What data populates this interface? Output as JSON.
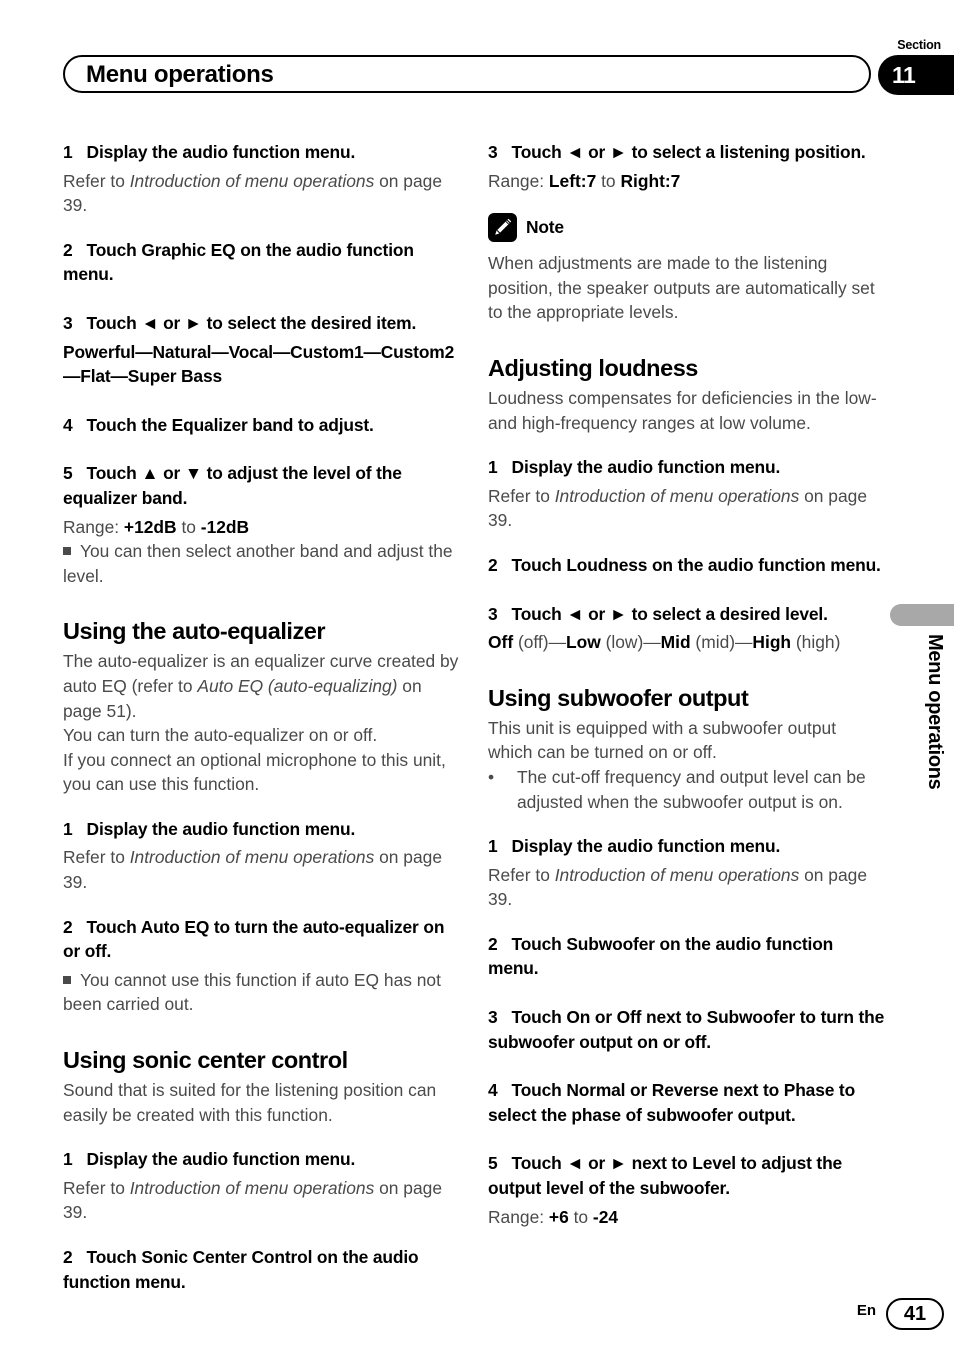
{
  "header": {
    "title": "Menu operations",
    "section_label": "Section",
    "section_number": "11"
  },
  "side_tab": {
    "label": "Menu operations"
  },
  "footer": {
    "language": "En",
    "page_number": "41"
  },
  "left_column": {
    "step1": {
      "num": "1",
      "text": "Display the audio function menu."
    },
    "step1_refer_pre": "Refer to ",
    "step1_refer_italic": "Introduction of menu operations",
    "step1_refer_post": " on page 39.",
    "step2": {
      "num": "2",
      "text": "Touch Graphic EQ on the audio function menu."
    },
    "step3": {
      "num": "3",
      "text": "Touch ◄ or ► to select the desired item."
    },
    "step3_items": "Powerful—Natural—Vocal—Custom1—Custom2—Flat—Super Bass",
    "step4": {
      "num": "4",
      "text": "Touch the Equalizer band to adjust."
    },
    "step5": {
      "num": "5",
      "text": "Touch ▲ or ▼ to adjust the level of the equalizer band."
    },
    "step5_range_label": "Range: ",
    "step5_range_from": "+12dB",
    "step5_range_mid": " to ",
    "step5_range_to": "-12dB",
    "step5_note": "You can then select another band and adjust the level.",
    "heading_auto_eq": "Using the auto-equalizer",
    "auto_eq_p1_a": "The auto-equalizer is an equalizer curve created by auto EQ (refer to ",
    "auto_eq_p1_italic": "Auto EQ (auto-equalizing)",
    "auto_eq_p1_b": " on page 51).",
    "auto_eq_p2": "You can turn the auto-equalizer on or off.",
    "auto_eq_p3": "If you connect an optional microphone to this unit, you can use this function.",
    "auto_eq_step1": {
      "num": "1",
      "text": "Display the audio function menu."
    },
    "auto_eq_step2": {
      "num": "2",
      "text": "Touch Auto EQ to turn the auto-equalizer on or off."
    },
    "auto_eq_step2_note": "You cannot use this function if auto EQ has not been carried out.",
    "heading_sonic": "Using sonic center control",
    "sonic_p1": "Sound that is suited for the listening position can easily be created with this function.",
    "sonic_step1": {
      "num": "1",
      "text": "Display the audio function menu."
    },
    "sonic_step2": {
      "num": "2",
      "text": "Touch Sonic Center Control on the audio function menu."
    }
  },
  "right_column": {
    "step3": {
      "num": "3",
      "text": "Touch ◄ or ► to select a listening position."
    },
    "step3_range_label": "Range: ",
    "step3_range_from": "Left:7",
    "step3_range_mid": " to ",
    "step3_range_to": "Right:7",
    "note_label": "Note",
    "note_icon": "pencil-icon",
    "note_text": "When adjustments are made to the listening position, the speaker outputs are automatically set to the appropriate levels.",
    "heading_loudness": "Adjusting loudness",
    "loudness_p1": "Loudness compensates for deficiencies in the low- and high-frequency ranges at low volume.",
    "loudness_step1": {
      "num": "1",
      "text": "Display the audio function menu."
    },
    "loudness_step2": {
      "num": "2",
      "text": "Touch Loudness on the audio function menu."
    },
    "loudness_step3": {
      "num": "3",
      "text": "Touch ◄ or ► to select a desired level."
    },
    "loudness_options": [
      {
        "bold": "Off",
        "plain": " (off)"
      },
      {
        "bold": "Low",
        "plain": " (low)"
      },
      {
        "bold": "Mid",
        "plain": " (mid)"
      },
      {
        "bold": "High",
        "plain": " (high)"
      }
    ],
    "heading_subwoofer": "Using subwoofer output",
    "sub_p1": "This unit is equipped with a subwoofer output which can be turned on or off.",
    "sub_bullet": "The cut-off frequency and output level can be adjusted when the subwoofer output is on.",
    "sub_step1": {
      "num": "1",
      "text": "Display the audio function menu."
    },
    "sub_step2": {
      "num": "2",
      "text": "Touch Subwoofer on the audio function menu."
    },
    "sub_step3": {
      "num": "3",
      "text": "Touch On or Off next to Subwoofer to turn the subwoofer output on or off."
    },
    "sub_step4": {
      "num": "4",
      "text": "Touch Normal or Reverse next to Phase to select the phase of subwoofer output."
    },
    "sub_step5": {
      "num": "5",
      "text": "Touch ◄ or ► next to Level to adjust the output level of the subwoofer."
    },
    "sub_step5_range_label": "Range: ",
    "sub_step5_range_from": "+6",
    "sub_step5_range_mid": " to ",
    "sub_step5_range_to": "-24"
  },
  "shared": {
    "refer_pre": "Refer to ",
    "refer_italic": "Introduction of menu operations",
    "refer_post": " on page 39.",
    "bullet_square": "▪",
    "bullet_dot": "•"
  }
}
